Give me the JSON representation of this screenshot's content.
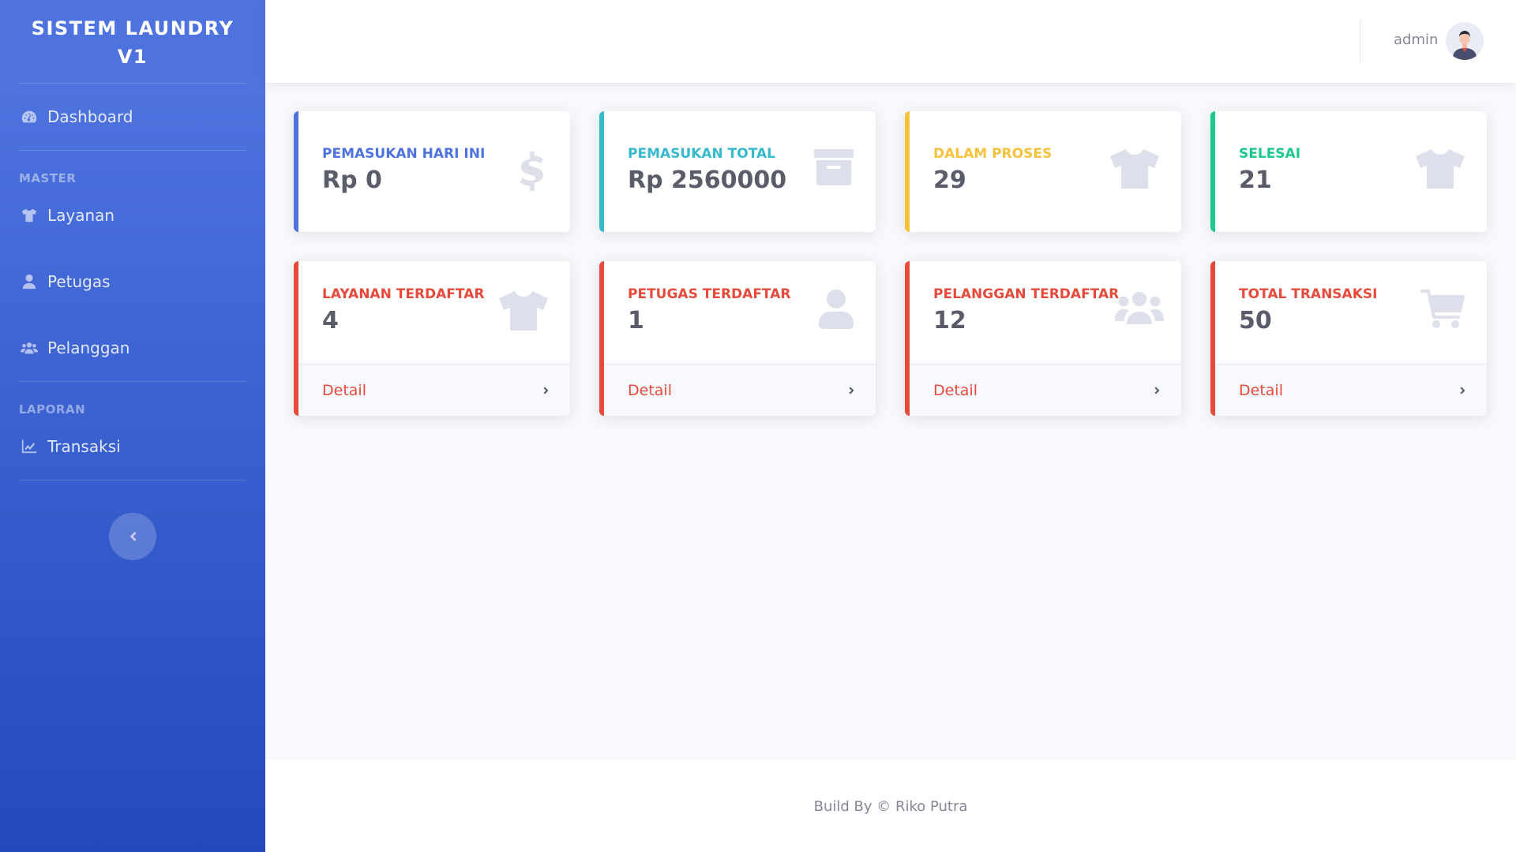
{
  "sidebar": {
    "brand": "SISTEM LAUNDRY V1",
    "dashboard_label": "Dashboard",
    "heading_master": "MASTER",
    "layanan_label": "Layanan",
    "petugas_label": "Petugas",
    "pelanggan_label": "Pelanggan",
    "heading_laporan": "LAPORAN",
    "transaksi_label": "Transaksi"
  },
  "topbar": {
    "user_name": "admin"
  },
  "stats": [
    {
      "title": "PEMASUKAN HARI INI",
      "value": "Rp 0",
      "color": "#4e73df",
      "icon": "dollar-icon"
    },
    {
      "title": "PEMASUKAN TOTAL",
      "value": "Rp 2560000",
      "color": "#36b9cc",
      "icon": "archive-icon"
    },
    {
      "title": "DALAM PROSES",
      "value": "29",
      "color": "#f6c23e",
      "icon": "shirt-icon"
    },
    {
      "title": "SELESAI",
      "value": "21",
      "color": "#1cc88a",
      "icon": "shirt-icon"
    }
  ],
  "detail_cards": [
    {
      "title": "LAYANAN TERDAFTAR",
      "value": "4",
      "link": "Detail",
      "color": "#e74a3b",
      "icon": "shirt-icon"
    },
    {
      "title": "PETUGAS TERDAFTAR",
      "value": "1",
      "link": "Detail",
      "color": "#e74a3b",
      "icon": "user-icon"
    },
    {
      "title": "PELANGGAN TERDAFTAR",
      "value": "12",
      "link": "Detail",
      "color": "#e74a3b",
      "icon": "users-icon"
    },
    {
      "title": "TOTAL TRANSAKSI",
      "value": "50",
      "link": "Detail",
      "color": "#e74a3b",
      "icon": "cart-icon"
    }
  ],
  "footer": {
    "text": "Build By © Riko Putra"
  }
}
